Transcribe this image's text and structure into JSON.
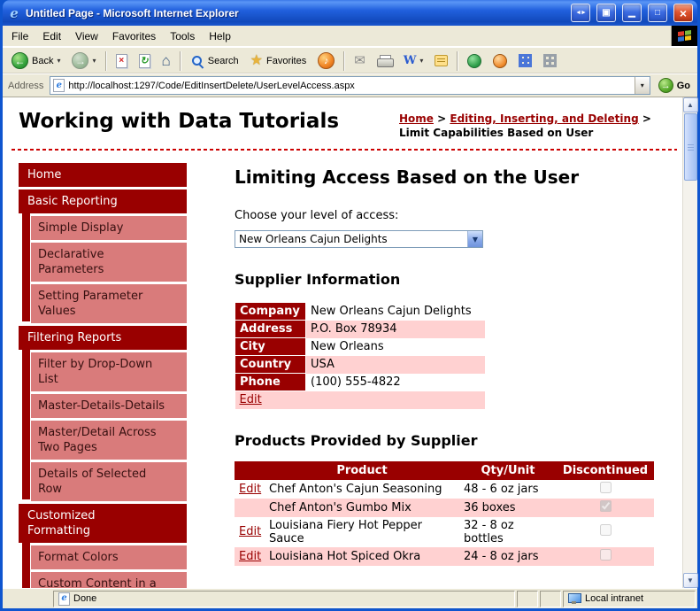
{
  "window": {
    "title": "Untitled Page - Microsoft Internet Explorer",
    "status_left": "Done",
    "status_zone": "Local intranet"
  },
  "menu": {
    "items": [
      "File",
      "Edit",
      "View",
      "Favorites",
      "Tools",
      "Help"
    ]
  },
  "toolbar": {
    "back_label": "Back",
    "search_label": "Search",
    "favorites_label": "Favorites"
  },
  "address": {
    "label": "Address",
    "url": "http://localhost:1297/Code/EditInsertDelete/UserLevelAccess.aspx",
    "go_label": "Go"
  },
  "icons": {
    "ie": "e",
    "back": "←",
    "forward": "→",
    "dropdown": "▾",
    "stop": "×",
    "refresh": "↻",
    "home": "⌂",
    "star": "★",
    "media": "♪",
    "mail": "✉",
    "edit_w": "W",
    "go": "→",
    "title_nav": "◄►",
    "title_page": "▣",
    "minimize": "▁",
    "maximize": "□",
    "close": "×",
    "combo_arrow": "▼",
    "scroll_up": "▲",
    "scroll_down": "▼"
  },
  "colors": {
    "maroon": "#990000",
    "sub_item_salmon": "#d97b7b",
    "row_pink": "#ffd1d1",
    "dashed_line_red": "#cc0000",
    "titlebar_blue": "#2160dd"
  },
  "page": {
    "site_title": "Working with Data Tutorials",
    "breadcrumb": {
      "home": "Home",
      "sep1": ">",
      "section": "Editing, Inserting, and Deleting",
      "sep2": ">",
      "current": "Limit Capabilities Based on User"
    },
    "sidebar": {
      "items": [
        {
          "label": "Home",
          "level": 0
        },
        {
          "label": "Basic Reporting",
          "level": 0
        },
        {
          "label": "Simple Display",
          "level": 1
        },
        {
          "label": "Declarative Parameters",
          "level": 1
        },
        {
          "label": "Setting Parameter Values",
          "level": 1
        },
        {
          "label": "Filtering Reports",
          "level": 0
        },
        {
          "label": "Filter by Drop-Down List",
          "level": 1
        },
        {
          "label": "Master-Details-Details",
          "level": 1
        },
        {
          "label": "Master/Detail Across Two Pages",
          "level": 1
        },
        {
          "label": "Details of Selected Row",
          "level": 1
        },
        {
          "label": "Customized Formatting",
          "level": 0
        },
        {
          "label": "Format Colors",
          "level": 1
        },
        {
          "label": "Custom Content in a",
          "level": 1
        }
      ]
    },
    "main": {
      "heading": "Limiting Access Based on the User",
      "access_label": "Choose your level of access:",
      "access_value": "New Orleans Cajun Delights",
      "supplier_heading": "Supplier Information",
      "supplier": {
        "rows": [
          {
            "label": "Company",
            "value": "New Orleans Cajun Delights"
          },
          {
            "label": "Address",
            "value": "P.O. Box 78934"
          },
          {
            "label": "City",
            "value": "New Orleans"
          },
          {
            "label": "Country",
            "value": "USA"
          },
          {
            "label": "Phone",
            "value": "(100) 555-4822"
          }
        ],
        "edit_label": "Edit"
      },
      "products_heading": "Products Provided by Supplier",
      "products": {
        "headers": [
          "",
          "Product",
          "Qty/Unit",
          "Discontinued"
        ],
        "rows": [
          {
            "edit": "Edit",
            "name": "Chef Anton's Cajun Seasoning",
            "qty": "48 - 6 oz jars",
            "discontinued": false
          },
          {
            "edit": "",
            "name": "Chef Anton's Gumbo Mix",
            "qty": "36 boxes",
            "discontinued": true
          },
          {
            "edit": "Edit",
            "name": "Louisiana Fiery Hot Pepper Sauce",
            "qty": "32 - 8 oz bottles",
            "discontinued": false
          },
          {
            "edit": "Edit",
            "name": "Louisiana Hot Spiced Okra",
            "qty": "24 - 8 oz jars",
            "discontinued": false
          }
        ]
      }
    }
  }
}
